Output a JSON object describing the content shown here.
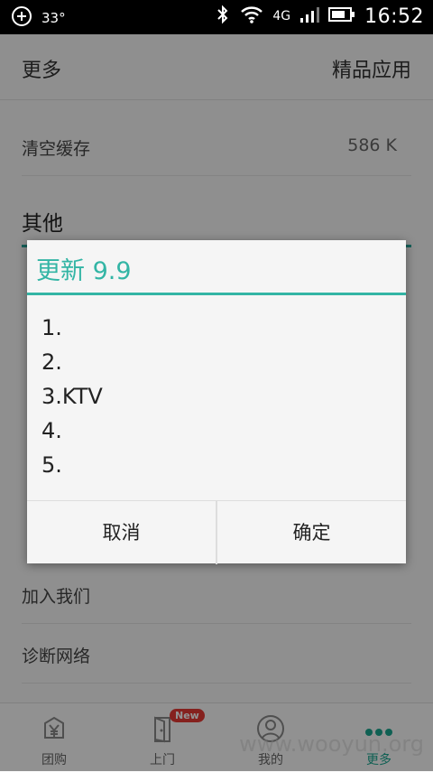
{
  "status_bar": {
    "temperature": "33°",
    "network": "4G",
    "time": "16:52"
  },
  "header": {
    "title": "更多",
    "right_link": "精品应用"
  },
  "settings": {
    "clear_cache_label": "清空缓存",
    "clear_cache_value": "586 K",
    "section_title": "其他",
    "rows": [
      "加入我们",
      "诊断网络"
    ]
  },
  "tabbar": {
    "tabs": [
      {
        "label": "团购",
        "icon": "yen-icon"
      },
      {
        "label": "上门",
        "icon": "door-icon",
        "badge": "New"
      },
      {
        "label": "我的",
        "icon": "user-icon"
      },
      {
        "label": "更多",
        "icon": "more-dots-icon",
        "active": true
      }
    ]
  },
  "dialog": {
    "title": "更新 9.9",
    "items": [
      "1.",
      "2.",
      "3.KTV",
      "4.",
      "5."
    ],
    "cancel_label": "取消",
    "confirm_label": "确定"
  },
  "watermark": "www.wooyun.org",
  "colors": {
    "accent": "#33b5a5",
    "status_bar_bg": "#000000",
    "badge": "#e53935"
  }
}
